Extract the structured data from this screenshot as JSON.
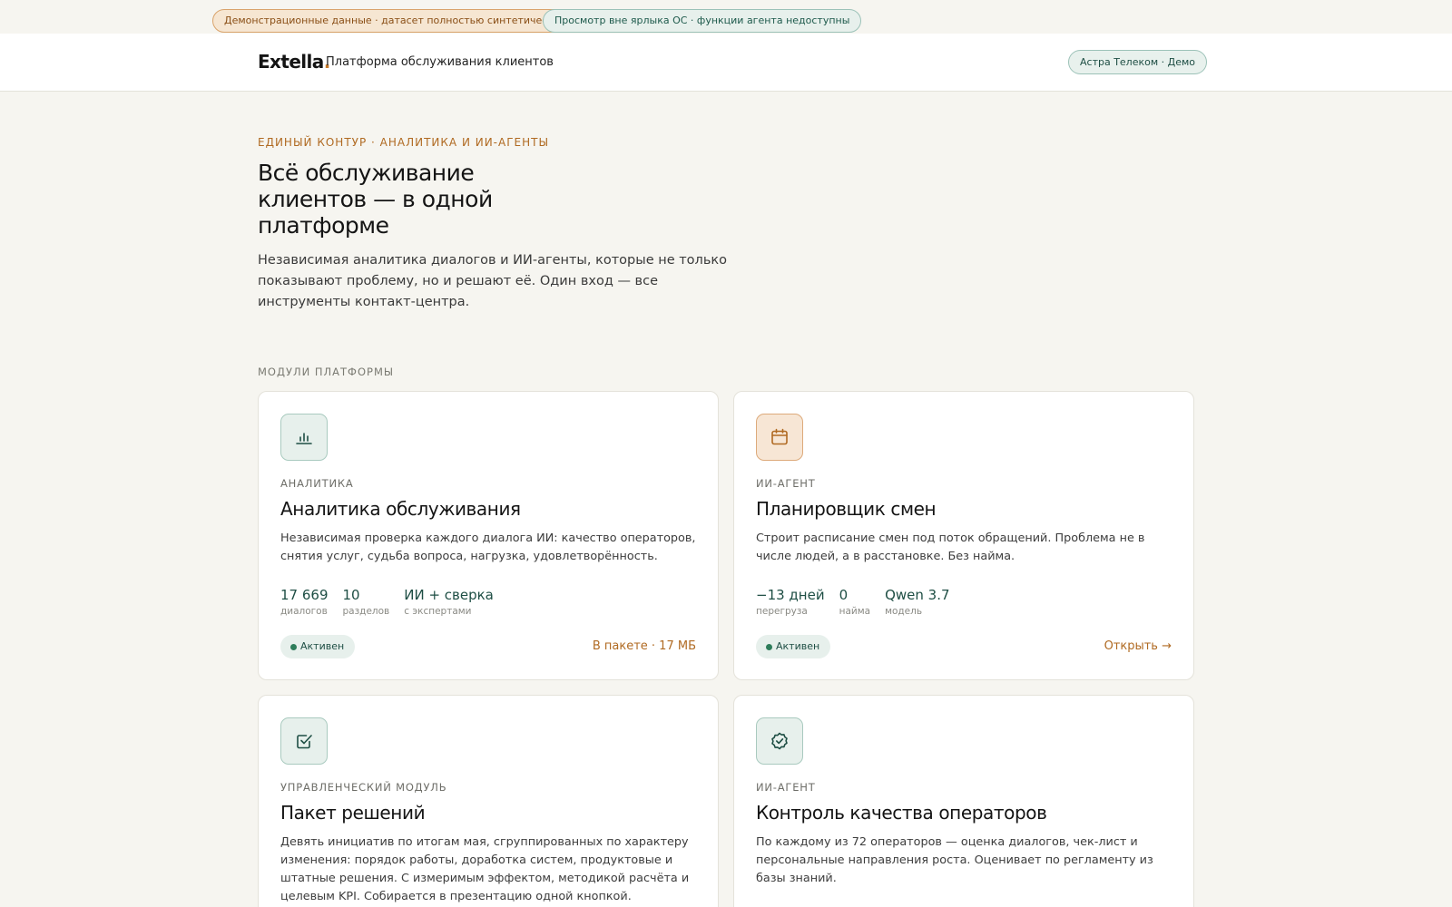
{
  "notices": {
    "demo": "Демонстрационные данные · датасет полностью синтетический",
    "view": "Просмотр вне ярлыка ОС · функции агента недоступны"
  },
  "header": {
    "logo": "Extella",
    "logo_dot": ".",
    "subtitle": "Платформа обслуживания клиентов",
    "tenant": "Астра Телеком · Демо"
  },
  "hero": {
    "eyebrow": "ЕДИНЫЙ КОНТУР · АНАЛИТИКА И ИИ-АГЕНТЫ",
    "title": "Всё обслуживание клиентов — в одной платформе",
    "description": "Независимая аналитика диалогов и ИИ-агенты, которые не только показывают проблему, но и решают её. Один вход — все инструменты контакт-центра."
  },
  "modules_label": "МОДУЛИ ПЛАТФОРМЫ",
  "cards": [
    {
      "icon": "bar-chart-icon",
      "kicker": "АНАЛИТИКА",
      "title": "Аналитика обслуживания",
      "description": "Независимая проверка каждого диалога ИИ: качество операторов, снятия услуг, судьба вопроса, нагрузка, удовлетворённость.",
      "stats": [
        {
          "value": "17 669",
          "label": "диалогов"
        },
        {
          "value": "10",
          "label": "разделов"
        },
        {
          "value": "ИИ + сверка",
          "label": "с экспертами"
        }
      ],
      "status": "Активен",
      "action": "В пакете · 17 МБ"
    },
    {
      "icon": "calendar-icon",
      "kicker": "ИИ-АГЕНТ",
      "title": "Планировщик смен",
      "description": "Строит расписание смен под поток обращений. Проблема не в числе людей, а в расстановке. Без найма.",
      "stats": [
        {
          "value": "−13 дней",
          "label": "перегруза"
        },
        {
          "value": "0",
          "label": "найма"
        },
        {
          "value": "Qwen 3.7",
          "label": "модель"
        }
      ],
      "status": "Активен",
      "action": "Открыть →"
    },
    {
      "icon": "checkbox-icon",
      "kicker": "УПРАВЛЕНЧЕСКИЙ МОДУЛЬ",
      "title": "Пакет решений",
      "description": "Девять инициатив по итогам мая, сгруппированных по характеру изменения: порядок работы, доработка систем, продуктовые и штатные решения. С измеримым эффектом, методикой расчёта и целевым KPI. Собирается в презентацию одной кнопкой."
    },
    {
      "icon": "verified-badge-icon",
      "kicker": "ИИ-АГЕНТ",
      "title": "Контроль качества операторов",
      "description": "По каждому из 72 операторов — оценка диалогов, чек-лист и персональные направления роста. Оценивает по регламенту из базы знаний."
    }
  ],
  "colors": {
    "accent_teal": "#1e4e44",
    "accent_orange": "#b06a22",
    "background": "#f6f5f0",
    "active_dot": "#2e7d5b"
  }
}
